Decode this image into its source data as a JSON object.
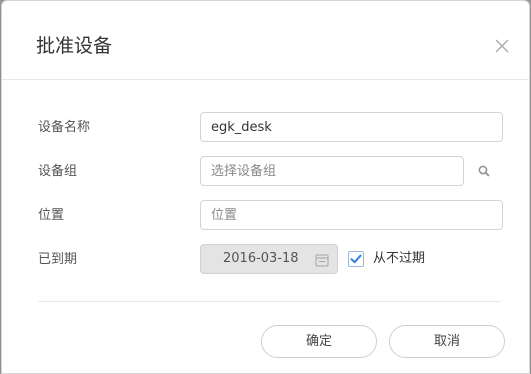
{
  "dialog": {
    "title": "批准设备",
    "close_icon": "close-icon"
  },
  "form": {
    "device_name": {
      "label": "设备名称",
      "value": "egk_desk"
    },
    "device_group": {
      "label": "设备组",
      "placeholder": "选择设备组",
      "icon": "search-icon"
    },
    "location": {
      "label": "位置",
      "placeholder": "位置"
    },
    "expiry": {
      "label": "已到期",
      "date_value": "2016-03-18",
      "icon": "calendar-icon",
      "never_expire_label": "从不过期",
      "never_expire_checked": true
    }
  },
  "footer": {
    "confirm_label": "确定",
    "cancel_label": "取消"
  },
  "colors": {
    "check_accent": "#2f7fd9",
    "input_border": "#d4d4d4",
    "disabled_bg": "#e4e4e4"
  }
}
